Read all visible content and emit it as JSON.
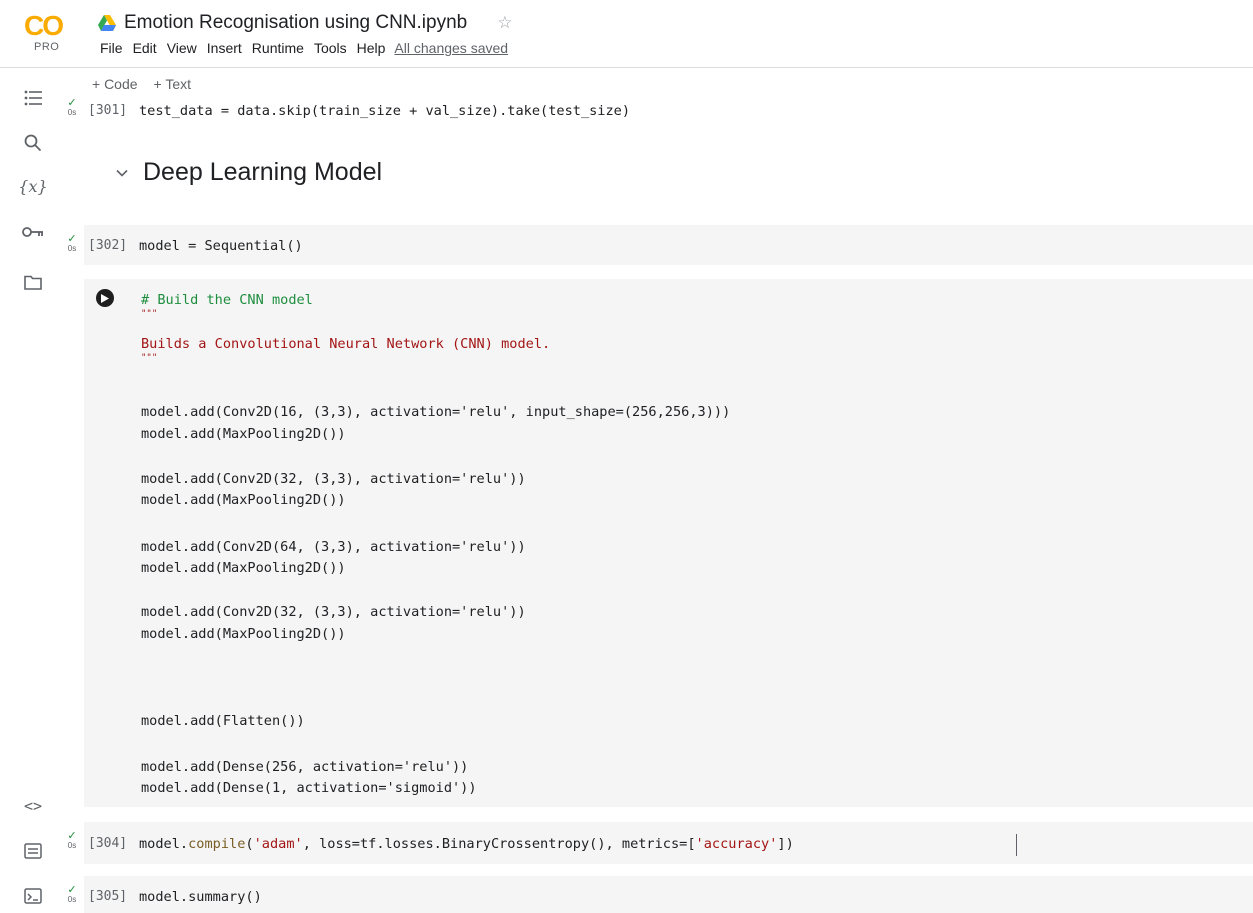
{
  "app": {
    "logo_text": "CO",
    "logo_badge": "PRO",
    "notebook_title": "Emotion Recognisation using CNN.ipynb",
    "save_status": "All changes saved"
  },
  "menu": [
    "File",
    "Edit",
    "View",
    "Insert",
    "Runtime",
    "Tools",
    "Help"
  ],
  "toolbar": {
    "add_code": "+ Code",
    "add_text": "+ Text"
  },
  "rail_icons": [
    "table-of-contents-icon",
    "search-icon",
    "variables-icon",
    "secrets-key-icon",
    "files-folder-icon",
    "code-snippets-icon",
    "command-palette-icon",
    "terminal-icon"
  ],
  "rail_variables_text": "{x}",
  "rail_snippets_text": "<>",
  "cells": {
    "c301": {
      "count": "[301]",
      "time": "0s",
      "code": "test_data = data.skip(train_size + val_size).take(test_size)"
    },
    "section": {
      "heading": "Deep Learning Model"
    },
    "c302": {
      "count": "[302]",
      "time": "0s",
      "code": "model = Sequential()"
    },
    "c304": {
      "count": "[304]",
      "time": "0s"
    },
    "c305": {
      "count": "[305]",
      "time": "0s",
      "code": "model.summary()"
    }
  },
  "build_cell": {
    "comment": "# Build the CNN model",
    "docq1": "\"\"\"",
    "doc": "Builds a Convolutional Neural Network (CNN) model.",
    "docq2": "\"\"\"",
    "l1": "model.add(Conv2D(16, (3,3), activation='relu', input_shape=(256,256,3)))",
    "l2": "model.add(MaxPooling2D())",
    "l3": "model.add(Conv2D(32, (3,3), activation='relu'))",
    "l4": "model.add(MaxPooling2D())",
    "l5": "model.add(Conv2D(64, (3,3), activation='relu'))",
    "l6": "model.add(MaxPooling2D())",
    "l7": "model.add(Conv2D(32, (3,3), activation='relu'))",
    "l8": "model.add(MaxPooling2D())",
    "l9": "model.add(Flatten())",
    "l10": "model.add(Dense(256, activation='relu'))",
    "l11": "model.add(Dense(1, activation='sigmoid'))"
  },
  "compile_line": {
    "a": "model.",
    "b": "compile",
    "c": "(",
    "d": "'adam'",
    "e": ", loss=tf.losses.BinaryCrossentropy(), metrics=[",
    "f": "'accuracy'",
    "g": "])"
  },
  "colors": {
    "accent_orange": "#f9ab00",
    "check_green": "#1e8e3e",
    "cell_bg": "#f5f5f5",
    "string_red": "#a31515"
  }
}
